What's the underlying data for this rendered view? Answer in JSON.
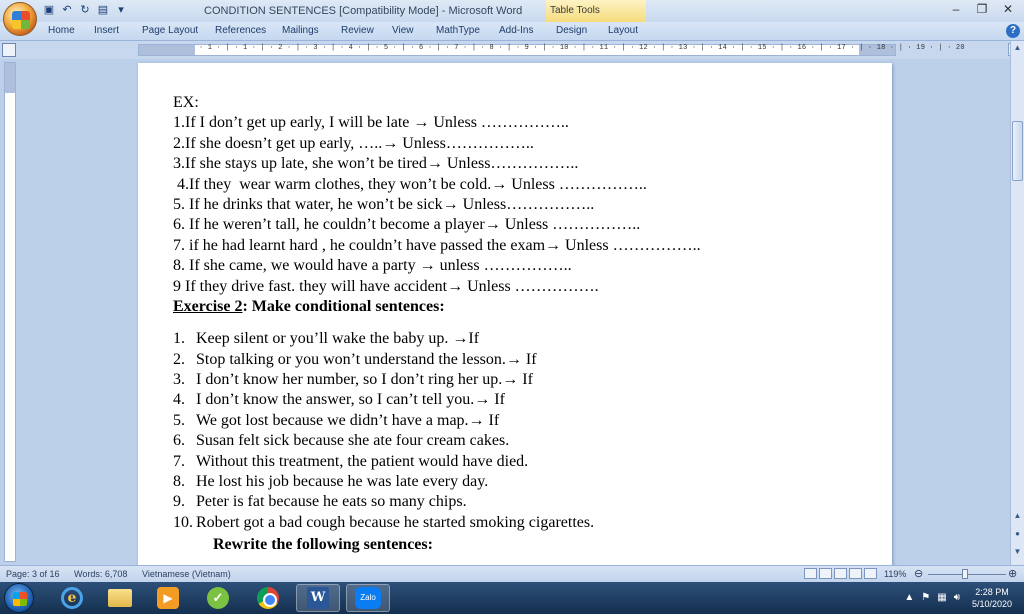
{
  "window": {
    "title": "CONDITION  SENTENCES [Compatibility Mode] - Microsoft Word",
    "context_tab": "Table Tools"
  },
  "ribbon": {
    "tabs": [
      "Home",
      "Insert",
      "Page Layout",
      "References",
      "Mailings",
      "Review",
      "View",
      "MathType",
      "Add-Ins",
      "Design",
      "Layout"
    ]
  },
  "ruler": {
    "numbers": "· 1 · | · 1 · | · 2 · | · 3 · | · 4 · | · 5 · | · 6 · | · 7 · | · 8 · | · 9 · | · 10 · | · 11 · | · 12 · | · 13 · | · 14 · | · 15 · | · 16 · | · 17 · | · 18 · | · 19 · | · 20"
  },
  "document": {
    "ex_label": "EX:",
    "ex_lines": [
      "1.If  I don’t get up early, I will be late → Unless ……………..",
      "2.If she doesn’t get up early, …..→ Unless……………..",
      "3.If she stays up late, she won’t be tired→ Unless……………..",
      " 4.If they  wear warm clothes, they won’t be cold.→ Unless ……………..",
      "5. If he drinks that water, he won’t be sick→ Unless……………..",
      "6. If he weren’t tall, he couldn’t become a player→ Unless ……………..",
      "7. if he had learnt hard , he couldn’t have passed the exam→ Unless ……………..",
      "8. If she came, we would have a party → unless ……………..",
      "9 If they drive fast. they will have accident→ Unless ……………."
    ],
    "exercise2_label": "Exercise 2",
    "exercise2_rest": ": Make conditional  sentences:",
    "exercise2_items": [
      {
        "n": "1.",
        "t": "Keep silent or you’ll wake the baby up. →If"
      },
      {
        "n": "2.",
        "t": "Stop talking or you won’t understand the lesson.→ If"
      },
      {
        "n": "3.",
        "t": "I don’t know her number, so I don’t ring her up.→ If"
      },
      {
        "n": "4.",
        "t": "I don’t know the answer, so I can’t tell you.→ If"
      },
      {
        "n": "5.",
        "t": "We got lost because we didn’t have a map.→ If"
      },
      {
        "n": "6.",
        "t": "Susan felt sick because she ate four cream cakes."
      },
      {
        "n": "7.",
        "t": "Without this treatment, the patient would have died."
      },
      {
        "n": "8.",
        "t": "He lost his job because he was late every day."
      },
      {
        "n": "9.",
        "t": "Peter is fat because he eats so many chips."
      },
      {
        "n": "10.",
        "t": "Robert got a bad cough because he started smoking cigarettes."
      }
    ],
    "rewrite_heading": "Rewrite the following sentences:"
  },
  "status": {
    "page": "Page: 3 of 16",
    "words": "Words: 6,708",
    "language": "Vietnamese (Vietnam)",
    "zoom": "119%"
  },
  "taskbar": {
    "zalo_label": "Zalo",
    "time": "2:28 PM",
    "date": "5/10/2020"
  },
  "icons": [
    "office-button-icon",
    "save-icon",
    "undo-icon",
    "redo-icon",
    "help-icon",
    "start-icon",
    "ie-icon",
    "folder-icon",
    "media-player-icon",
    "chrome-icon",
    "word-icon",
    "zalo-icon",
    "speaker-icon",
    "network-icon",
    "flag-icon"
  ]
}
